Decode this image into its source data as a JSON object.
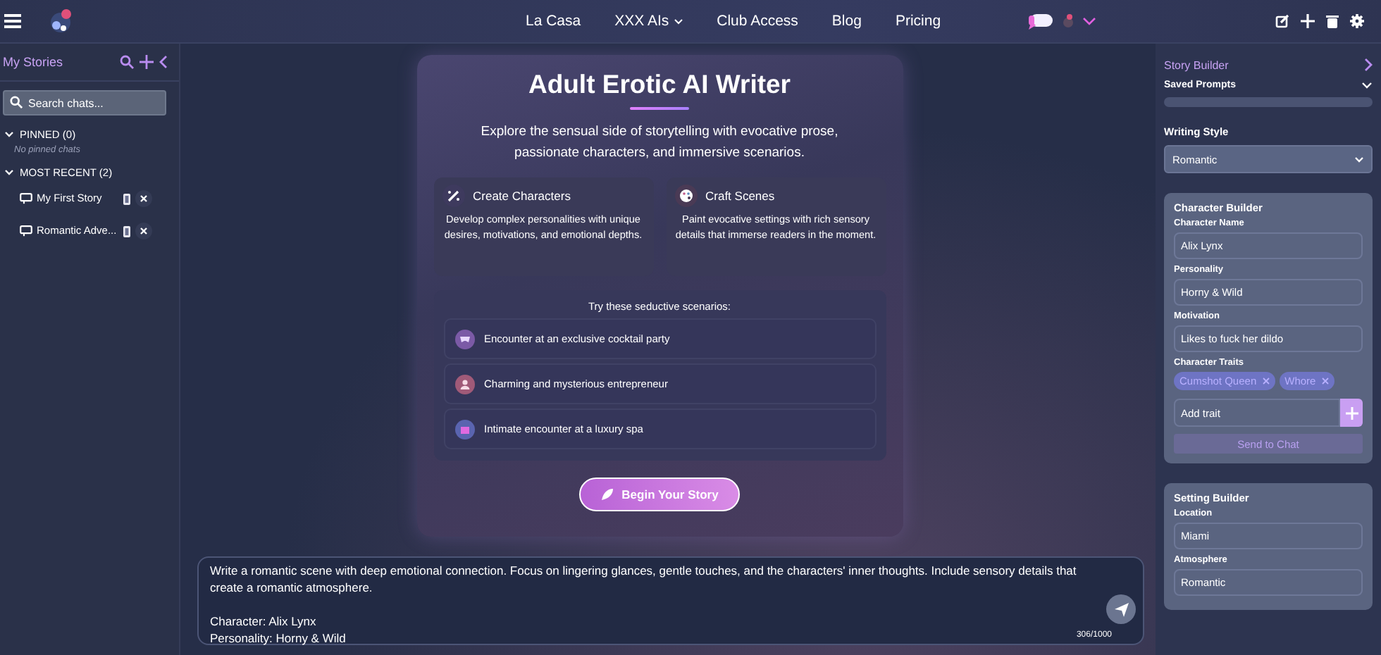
{
  "nav": {
    "items": [
      {
        "label": "La Casa",
        "dropdown": false
      },
      {
        "label": "XXX AIs",
        "dropdown": true
      },
      {
        "label": "Club Access",
        "dropdown": false
      },
      {
        "label": "Blog",
        "dropdown": false
      },
      {
        "label": "Pricing",
        "dropdown": false
      }
    ]
  },
  "sidebar": {
    "title": "My Stories",
    "search": {
      "placeholder": "Search chats..."
    },
    "sections": [
      {
        "label": "PINNED (0)",
        "expanded": true,
        "empty_text": "No pinned chats"
      },
      {
        "label": "MOST RECENT (2)",
        "expanded": true,
        "items": [
          {
            "title": "My First Story"
          },
          {
            "title": "Romantic Adve..."
          }
        ]
      }
    ]
  },
  "hero": {
    "title": "Adult Erotic AI Writer",
    "subtitle": "Explore the sensual side of storytelling with evocative prose, passionate characters, and immersive scenarios.",
    "features": [
      {
        "kind": "wand",
        "title": "Create Characters",
        "text": "Develop complex personalities with unique desires, motivations, and emotional depths."
      },
      {
        "kind": "palette",
        "title": "Craft Scenes",
        "text": "Paint evocative settings with rich sensory details that immerse readers in the moment."
      }
    ],
    "scenarios_title": "Try these seductive scenarios:",
    "scenarios": [
      {
        "kind": "mask",
        "color": "#7b5aa6",
        "text": "Encounter at an exclusive cocktail party"
      },
      {
        "kind": "person",
        "color": "#a05a78",
        "text": "Charming and mysterious entrepreneur"
      },
      {
        "kind": "spa",
        "color": "#5a64b0",
        "text": "Intimate encounter at a luxury spa"
      }
    ],
    "button": "Begin Your Story"
  },
  "prompt": {
    "value": "Write a romantic scene with deep emotional connection. Focus on lingering glances, gentle touches, and the characters' inner thoughts. Include sensory details that create a romantic atmosphere.\n\nCharacter: Alix Lynx\nPersonality: Horny & Wild",
    "counter": "306/1000"
  },
  "builder": {
    "title": "Story Builder",
    "saved_prompts": {
      "label": "Saved Prompts",
      "expanded": false
    },
    "writing_style": {
      "label": "Writing Style",
      "value": "Romantic"
    },
    "character": {
      "title": "Character Builder",
      "fields": [
        {
          "label": "Character Name",
          "value": "Alix Lynx"
        },
        {
          "label": "Personality",
          "value": "Horny & Wild"
        },
        {
          "label": "Motivation",
          "value": "Likes to fuck her dildo"
        }
      ],
      "traits_label": "Character Traits",
      "traits": [
        "Cumshot Queen",
        "Whore"
      ],
      "add_placeholder": "Add trait",
      "send": "Send to Chat"
    },
    "setting": {
      "title": "Setting Builder",
      "fields": [
        {
          "label": "Location",
          "value": "Miami"
        },
        {
          "label": "Atmosphere",
          "value": "Romantic"
        }
      ]
    }
  }
}
